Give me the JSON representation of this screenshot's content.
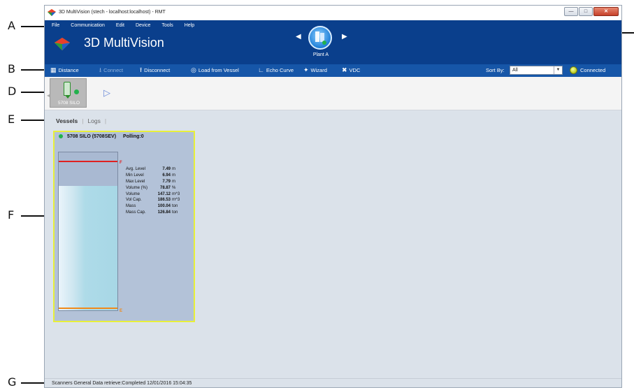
{
  "callouts": {
    "a": "A",
    "b": "B",
    "d": "D",
    "e": "E",
    "f": "F",
    "g": "G"
  },
  "titlebar": {
    "title": "3D MultiVision (stech - localhost:localhost) - RMT"
  },
  "menu": {
    "file": "File",
    "communication": "Communication",
    "edit": "Edit",
    "device": "Device",
    "tools": "Tools",
    "help": "Help"
  },
  "header": {
    "app_name": "3D MultiVision",
    "plant": "Plant A"
  },
  "toolbar": {
    "distance": "Distance",
    "connect": "Connect",
    "disconnect": "Disconnect",
    "load_from_vessel": "Load from Vessel",
    "echo_curve": "Echo Curve",
    "wizard": "Wizard",
    "vdc": "VDC",
    "sort_by_label": "Sort By:",
    "sort_by_value": "All",
    "status": "Connected"
  },
  "vessel_strip": {
    "selected_vessel": "5708 SILO"
  },
  "tabs": {
    "vessels": "Vessels",
    "logs": "Logs"
  },
  "vessel_card": {
    "name": "5708 SILO (5708SEV)",
    "polling": "Polling:0",
    "fill_fraction": 0.7887,
    "full_marker": "F",
    "empty_marker": "E",
    "stats": [
      {
        "label": "Avg. Level",
        "value": "7.49",
        "unit": "m"
      },
      {
        "label": "Min Level",
        "value": "6.94",
        "unit": "m"
      },
      {
        "label": "Max Level",
        "value": "7.79",
        "unit": "m"
      },
      {
        "label": "Volume (%)",
        "value": "78.87",
        "unit": "%"
      },
      {
        "label": "Volume",
        "value": "147.12",
        "unit": "m^3"
      },
      {
        "label": "Vol Cap.",
        "value": "186.53",
        "unit": "m^3"
      },
      {
        "label": "Mass",
        "value": "100.04",
        "unit": "ton"
      },
      {
        "label": "Mass Cap.",
        "value": "126.84",
        "unit": "ton"
      }
    ]
  },
  "statusbar": {
    "message": "Scanners General Data retrieve:Completed 12/01/2016 15:04:35"
  },
  "colors": {
    "header_bg": "#0a3f8c",
    "toolbar_bg": "#1656a8",
    "card_border": "#e8ef3a",
    "full_line": "#e02020",
    "empty_line": "#f08a1a",
    "connected_led": "#b7c91d"
  }
}
